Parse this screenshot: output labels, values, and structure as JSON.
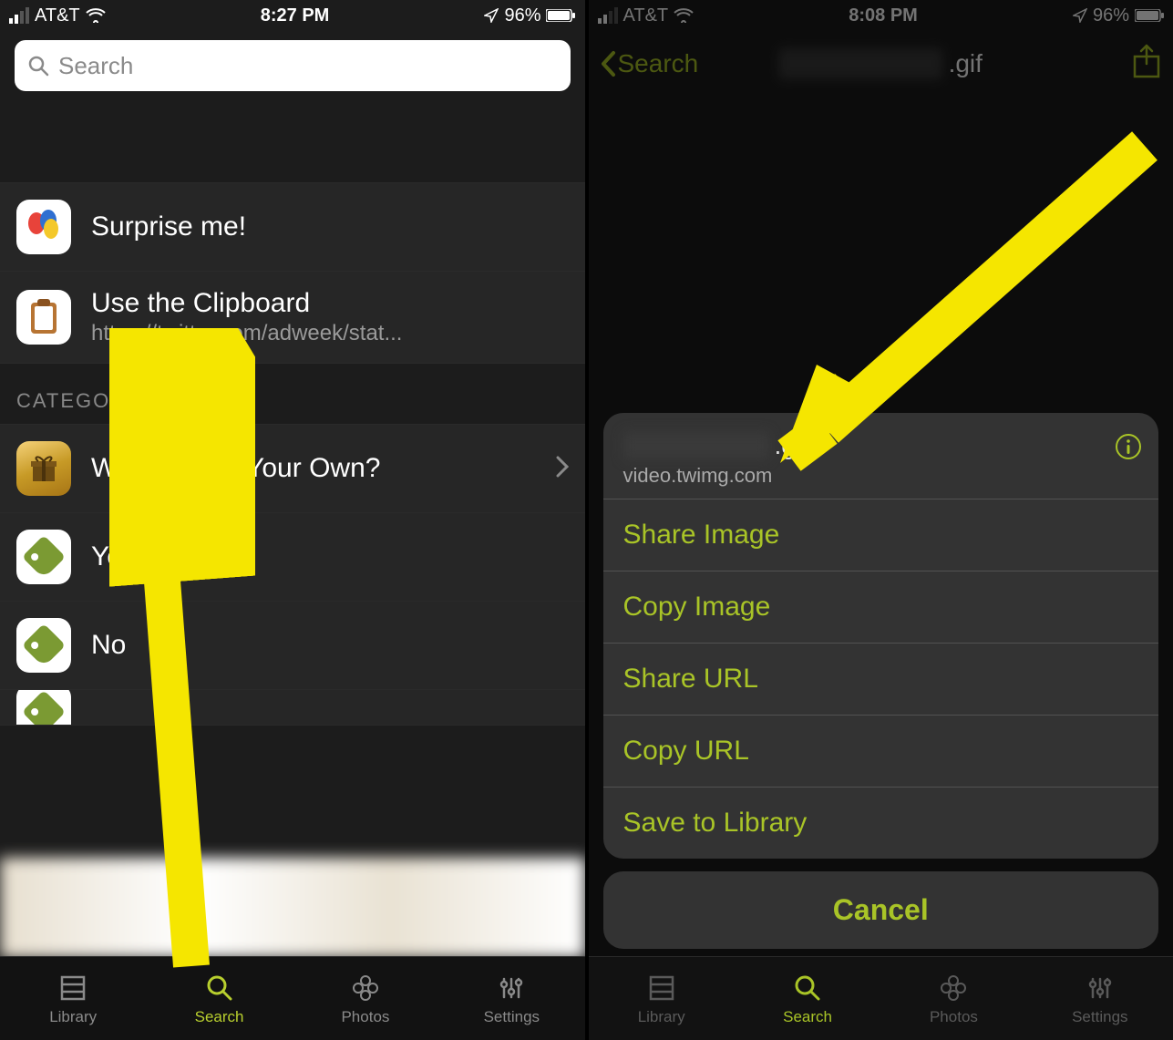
{
  "left": {
    "status": {
      "carrier": "AT&T",
      "time": "8:27 PM",
      "battery": "96%"
    },
    "search": {
      "placeholder": "Search"
    },
    "rows": {
      "surprise": {
        "title": "Surprise me!"
      },
      "clipboard": {
        "title": "Use the Clipboard",
        "sub": "https://twitter.com/adweek/stat..."
      }
    },
    "section_header": "CATEGORIES",
    "categories": {
      "addown": "Want to Add Your Own?",
      "yes": "Yes",
      "no": "No"
    },
    "tabs": {
      "library": "Library",
      "search": "Search",
      "photos": "Photos",
      "settings": "Settings"
    }
  },
  "right": {
    "status": {
      "carrier": "AT&T",
      "time": "8:08 PM",
      "battery": "96%"
    },
    "nav": {
      "back": "Search",
      "title_suffix": ".gif"
    },
    "sheet": {
      "file_suffix": ".gif",
      "sub": "video.twimg.com",
      "items": [
        "Share Image",
        "Copy Image",
        "Share URL",
        "Copy URL",
        "Save to Library"
      ],
      "cancel": "Cancel"
    },
    "tabs": {
      "library": "Library",
      "search": "Search",
      "photos": "Photos",
      "settings": "Settings"
    }
  },
  "accent": "#a9c427"
}
